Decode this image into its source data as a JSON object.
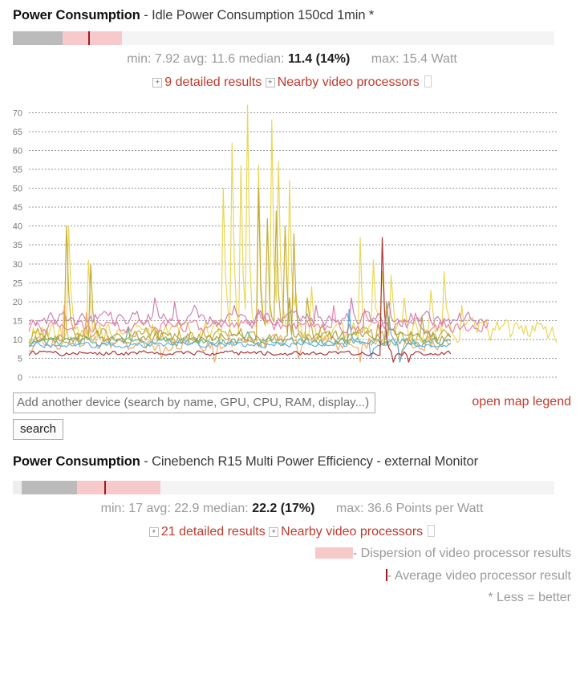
{
  "sections": [
    {
      "title_strong": "Power Consumption",
      "title_rest": " - Idle Power Consumption 150cd 1min *",
      "gauge": {
        "pre_pct": 0,
        "gray_pct": 9.2,
        "pink_pct": 10.9,
        "marker_pct": 13.9
      },
      "stats": {
        "min_label": "min: 7.92",
        "avg_label": "avg: 11.6",
        "median_label": "median:",
        "median_value": "11.4 (14%)",
        "max_label": "max: 15.4 Watt"
      },
      "links": {
        "plus": "+",
        "detailed": "9 detailed results",
        "nearby": "Nearby video processors"
      }
    },
    {
      "title_strong": "Power Consumption",
      "title_rest": " - Cinebench R15 Multi Power Efficiency - external Monitor",
      "gauge": {
        "pre_pct": 1.6,
        "gray_pct": 10.2,
        "pink_pct": 15.4,
        "marker_pct": 16.9
      },
      "stats": {
        "min_label": "min: 17",
        "avg_label": "avg: 22.9",
        "median_label": "median:",
        "median_value": "22.2 (17%)",
        "max_label": "max: 36.6 Points per Watt"
      },
      "links": {
        "plus": "+",
        "detailed": "21 detailed results",
        "nearby": "Nearby video processors"
      }
    }
  ],
  "search": {
    "placeholder": "Add another device (search by name, GPU, CPU, RAM, display...)",
    "value": "",
    "button_label": "search",
    "map_legend_label": "open map legend"
  },
  "legend": [
    {
      "swatch": "dispersion-swatch",
      "text": "- Dispersion of video processor results"
    },
    {
      "swatch": "average-tick",
      "text": "- Average video processor result"
    },
    {
      "swatch": "none",
      "text": "* Less = better"
    }
  ],
  "colors": {
    "accent_red": "#c0392b",
    "marker_red": "#9e1b20",
    "dispersion_pink": "#f8c9cb",
    "gauge_gray": "#bbbbbb",
    "muted_text": "#9a9a9a"
  },
  "chart_data": {
    "type": "line",
    "title": "",
    "xlabel": "",
    "ylabel": "",
    "ylim": [
      0,
      72
    ],
    "yticks": [
      0,
      5,
      10,
      15,
      20,
      25,
      30,
      35,
      40,
      45,
      50,
      55,
      60,
      65,
      70
    ],
    "grid": true,
    "xticks": [],
    "legend_position": "none",
    "x_count": 240,
    "series": [
      {
        "name": "series-yellow-spiky",
        "color": "#e8d44a",
        "base": 12.0,
        "noise": 4.2,
        "seed": 11,
        "spikes": [
          [
            18,
            40
          ],
          [
            27,
            31
          ],
          [
            88,
            50
          ],
          [
            92,
            62
          ],
          [
            96,
            56
          ],
          [
            99,
            72
          ],
          [
            104,
            56
          ],
          [
            110,
            68
          ],
          [
            113,
            57
          ],
          [
            118,
            52
          ],
          [
            121,
            22
          ],
          [
            128,
            24
          ],
          [
            150,
            37
          ],
          [
            156,
            31
          ],
          [
            160,
            28
          ],
          [
            164,
            27
          ],
          [
            170,
            21
          ],
          [
            182,
            23
          ],
          [
            188,
            28
          ],
          [
            196,
            19
          ]
        ]
      },
      {
        "name": "series-gold",
        "color": "#bfa52e",
        "base": 11.0,
        "noise": 3.0,
        "seed": 23,
        "spikes": [
          [
            17,
            40
          ],
          [
            28,
            30
          ],
          [
            104,
            50
          ],
          [
            108,
            42
          ],
          [
            112,
            44
          ],
          [
            116,
            40
          ],
          [
            120,
            38
          ],
          [
            126,
            21
          ],
          [
            158,
            14
          ],
          [
            166,
            12
          ]
        ]
      },
      {
        "name": "series-magenta",
        "color": "#c77ab0",
        "base": 15.5,
        "noise": 2.6,
        "seed": 37,
        "spikes": [
          [
            57,
            21
          ],
          [
            66,
            20
          ],
          [
            75,
            19
          ],
          [
            93,
            19
          ],
          [
            130,
            19
          ],
          [
            146,
            21
          ],
          [
            163,
            20
          ]
        ]
      },
      {
        "name": "series-pink",
        "color": "#e87a9e",
        "base": 13.6,
        "noise": 2.4,
        "seed": 51,
        "spikes": [
          [
            104,
            18
          ],
          [
            138,
            19
          ],
          [
            152,
            18
          ],
          [
            175,
            17
          ]
        ]
      },
      {
        "name": "series-orange",
        "color": "#f0a35e",
        "base": 9.0,
        "noise": 2.9,
        "seed": 67,
        "spikes": [
          [
            16,
            19
          ],
          [
            26,
            17
          ],
          [
            60,
            5
          ],
          [
            84,
            4
          ],
          [
            122,
            5
          ],
          [
            150,
            4
          ],
          [
            168,
            4
          ]
        ]
      },
      {
        "name": "series-teal",
        "color": "#4fb39a",
        "base": 9.4,
        "noise": 1.6,
        "seed": 83,
        "spikes": [
          [
            45,
            13
          ],
          [
            99,
            12
          ]
        ]
      },
      {
        "name": "series-blue",
        "color": "#5aa7dd",
        "base": 8.6,
        "noise": 1.0,
        "seed": 97,
        "spikes": [
          [
            145,
            18
          ],
          [
            155,
            5
          ],
          [
            163,
            16
          ],
          [
            168,
            4
          ]
        ]
      },
      {
        "name": "series-darkred",
        "color": "#a32428",
        "base": 6.4,
        "noise": 0.9,
        "seed": 113,
        "spikes": [
          [
            160,
            37
          ],
          [
            165,
            4
          ],
          [
            172,
            4
          ]
        ]
      },
      {
        "name": "series-olive",
        "color": "#a89c3c",
        "base": 10.6,
        "noise": 2.2,
        "seed": 131,
        "spikes": [
          [
            118,
            21
          ],
          [
            162,
            20
          ],
          [
            178,
            16
          ]
        ]
      }
    ]
  }
}
